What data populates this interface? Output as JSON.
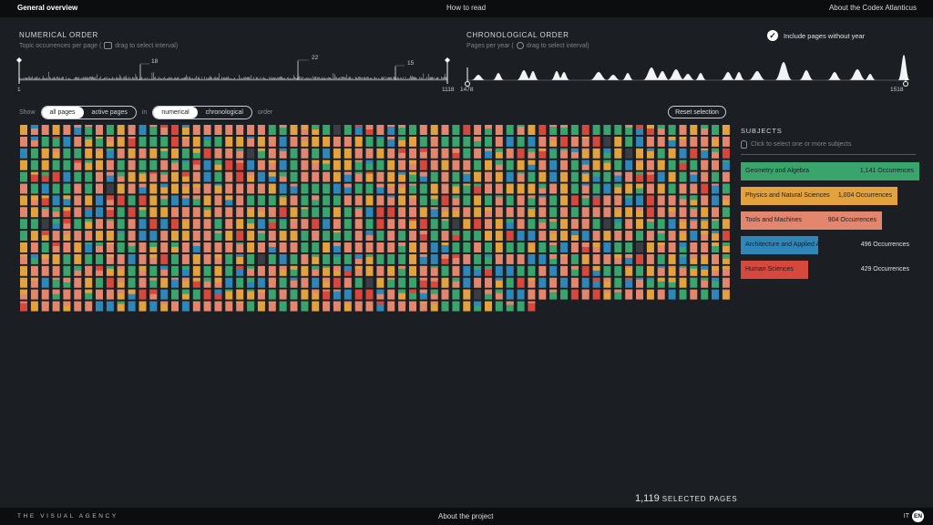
{
  "nav": {
    "overview": "General overview",
    "how_to_read": "How to read",
    "about_codex": "About the Codex Atlanticus"
  },
  "numerical": {
    "title": "NUMERICAL ORDER",
    "subtitle_pre": "Topic occurrences per page (",
    "subtitle_post": "drag to select interval)",
    "min_label": "1",
    "max_label": "1118",
    "peaks": [
      {
        "value": "18"
      },
      {
        "value": "22"
      },
      {
        "value": "15"
      }
    ]
  },
  "chronological": {
    "title": "CHRONOLOGICAL ORDER",
    "subtitle_pre": "Pages per year (",
    "subtitle_post": "drag to select interval)",
    "min_label": "1478",
    "max_label": "1518"
  },
  "include_without_year": {
    "label": "Include pages without year",
    "checked": true
  },
  "controls": {
    "show_label": "Show",
    "show_options": [
      "all pages",
      "active pages"
    ],
    "show_selected": "all pages",
    "in_label": "in",
    "order_options": [
      "numerical",
      "chronological"
    ],
    "order_selected": "numerical",
    "order_label": "order",
    "reset_label": "Reset selection"
  },
  "colors": {
    "geometry": "#3aa46d",
    "physics": "#e3a23e",
    "tools": "#e2876e",
    "architecture": "#2f86b8",
    "human": "#d6473c",
    "background": "#1b1e23"
  },
  "subjects": {
    "title": "SUBJECTS",
    "hint": "Click to select one or more subjects",
    "items": [
      {
        "name": "Geometry and Algebra",
        "occurrences": "1,141 Occurrences",
        "count": 1141,
        "color": "#3aa46d"
      },
      {
        "name": "Physics and Natural Sciences",
        "occurrences": "1,004 Occurrences",
        "count": 1004,
        "color": "#e3a23e"
      },
      {
        "name": "Tools and Machines",
        "occurrences": "904 Occurrences",
        "count": 904,
        "color": "#e2876e"
      },
      {
        "name": "Architecture and Applied Arts",
        "occurrences": "496 Occurrences",
        "count": 496,
        "color": "#2f86b8"
      },
      {
        "name": "Human Sciences",
        "occurrences": "429 Occurrences",
        "count": 429,
        "color": "#d6473c"
      }
    ]
  },
  "selection": {
    "count": "1,119",
    "label": "SELECTED PAGES"
  },
  "footer": {
    "brand": "THE VISUAL AGENCY",
    "about": "About the project",
    "lang_it": "IT",
    "lang_en": "EN"
  }
}
